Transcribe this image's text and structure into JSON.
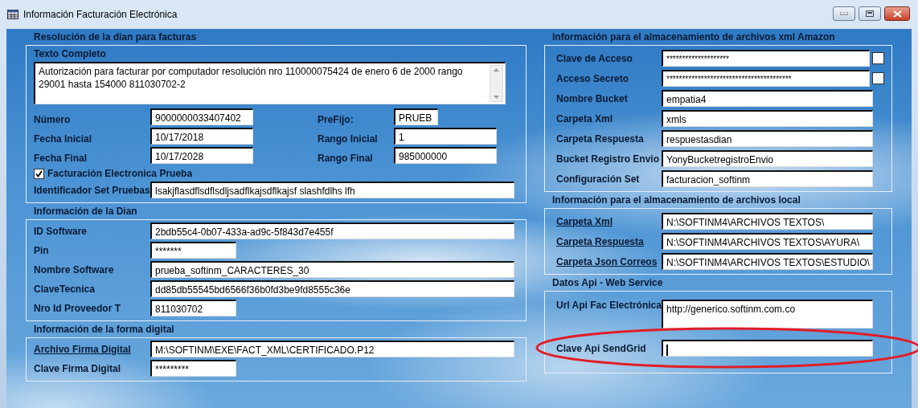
{
  "window": {
    "title": "Información Facturación Electrónica"
  },
  "resolution": {
    "heading": "Resolución de la dian para facturas",
    "text_label": "Texto Completo",
    "text_value": "Autorización para facturar por computador resolución nro 110000075424 de enero 6 de 2000 rango 29001 hasta 154000 811030702-2",
    "fields": [
      {
        "label": "Número",
        "value": "9000000033407402",
        "kind": "medium"
      },
      {
        "label": "PreFijo:",
        "value": "PRUEB",
        "kind": "tiny"
      },
      {
        "label": "Fecha Inicial",
        "value": "10/17/2018",
        "kind": "medium"
      },
      {
        "label": "Rango Inicial",
        "value": "1",
        "kind": "medium"
      },
      {
        "label": "Fecha Final",
        "value": "10/17/2028",
        "kind": "medium"
      },
      {
        "label": "Rango Final",
        "value": "985000000",
        "kind": "medium"
      }
    ],
    "checkbox": {
      "label": "Facturación Electronica Prueba",
      "checked": true
    },
    "set_label": "Identificador Set Pruebas",
    "set_value": "lsakjflasdflsdflsdljsadflkajsdflkajsf slashfdlhs lfh"
  },
  "dian": {
    "heading": "Información de la Dian",
    "rows": [
      {
        "label": "ID Software",
        "value": "2bdb55c4-0b07-433a-ad9c-5f843d7e455f",
        "kind": "long"
      },
      {
        "label": "Pin",
        "value": "*******",
        "kind": "short"
      },
      {
        "label": "Nombre Software",
        "value": "prueba_softinm_CARACTERES_30",
        "kind": "long"
      },
      {
        "label": "ClaveTecnica",
        "value": "dd85db55545bd6566f36b0fd3be9fd8555c36e",
        "kind": "long"
      },
      {
        "label": "Nro Id Proveedor T",
        "value": "811030702",
        "kind": "short"
      }
    ]
  },
  "digital": {
    "heading": "Información de la forma digital",
    "rows": [
      {
        "label": "Archivo Firma Digital",
        "value": "M:\\SOFTINM\\EXE\\FACT_XML\\CERTIFICADO.P12",
        "kind": "long",
        "link": true
      },
      {
        "label": "Clave Firma Digital",
        "value": "*********",
        "kind": "short",
        "link": false
      }
    ]
  },
  "amazon": {
    "heading": "Información para el almacenamiento de archivos xml Amazon",
    "rows": [
      {
        "label": "Clave de Acceso",
        "value": "********************",
        "kind": "check",
        "checked": false
      },
      {
        "label": "Acceso Secreto",
        "value": "****************************************",
        "kind": "check",
        "checked": false
      },
      {
        "label": "Nombre Bucket",
        "value": "empatia4",
        "kind": "plain"
      },
      {
        "label": "Carpeta Xml",
        "value": "xmls",
        "kind": "plain"
      },
      {
        "label": "Carpeta Respuesta",
        "value": "respuestasdian",
        "kind": "plain"
      },
      {
        "label": "Bucket Registro Envio",
        "value": "YonyBucketregistroEnvio",
        "kind": "plain"
      },
      {
        "label": "Configuración Set",
        "value": "facturacion_softinm",
        "kind": "plain"
      }
    ]
  },
  "local": {
    "heading": "Información para el almacenamiento de archivos local",
    "rows": [
      {
        "label": "Carpeta Xml",
        "value": "N:\\SOFTINM4\\ARCHIVOS TEXTOS\\",
        "link": true
      },
      {
        "label": "Carpeta Respuesta",
        "value": "N:\\SOFTINM4\\ARCHIVOS TEXTOS\\AYURA\\",
        "link": true
      },
      {
        "label": "Carpeta Json Correos",
        "value": "N:\\SOFTINM4\\ARCHIVOS TEXTOS\\ESTUDIO\\",
        "link": true
      }
    ]
  },
  "api": {
    "heading": "Datos Api - Web Service",
    "rows": [
      {
        "label": "Url Api Fac Electrónica",
        "value": "http://generico.softinm.com.co",
        "kind": "tall",
        "focused": false
      },
      {
        "label": "Clave Api SendGrid",
        "kind": "plain",
        "focused": true
      }
    ]
  },
  "highlight": {
    "kind": "ellipse"
  }
}
